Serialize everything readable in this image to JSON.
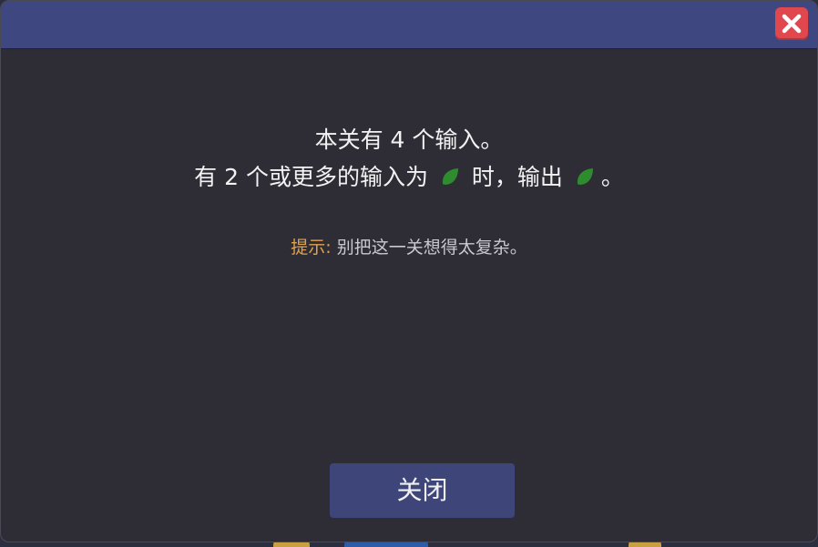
{
  "dialog": {
    "line1": "本关有 4 个输入。",
    "line2_before": "有 2 个或更多的输入为",
    "line2_middle": "时，输出",
    "line2_end": "。",
    "hint_label": "提示:",
    "hint_text": "别把这一关想得太复杂。",
    "close_button_label": "关闭"
  },
  "icons": {
    "value_icon": "green-leaf-icon",
    "window_close": "close-x-icon"
  },
  "colors": {
    "titlebar": "#3f4780",
    "body": "#2e2d35",
    "close_red": "#e0484e",
    "leaf_green": "#2e8b2e",
    "hint_label": "#e1a24d",
    "button": "#3e4579"
  }
}
